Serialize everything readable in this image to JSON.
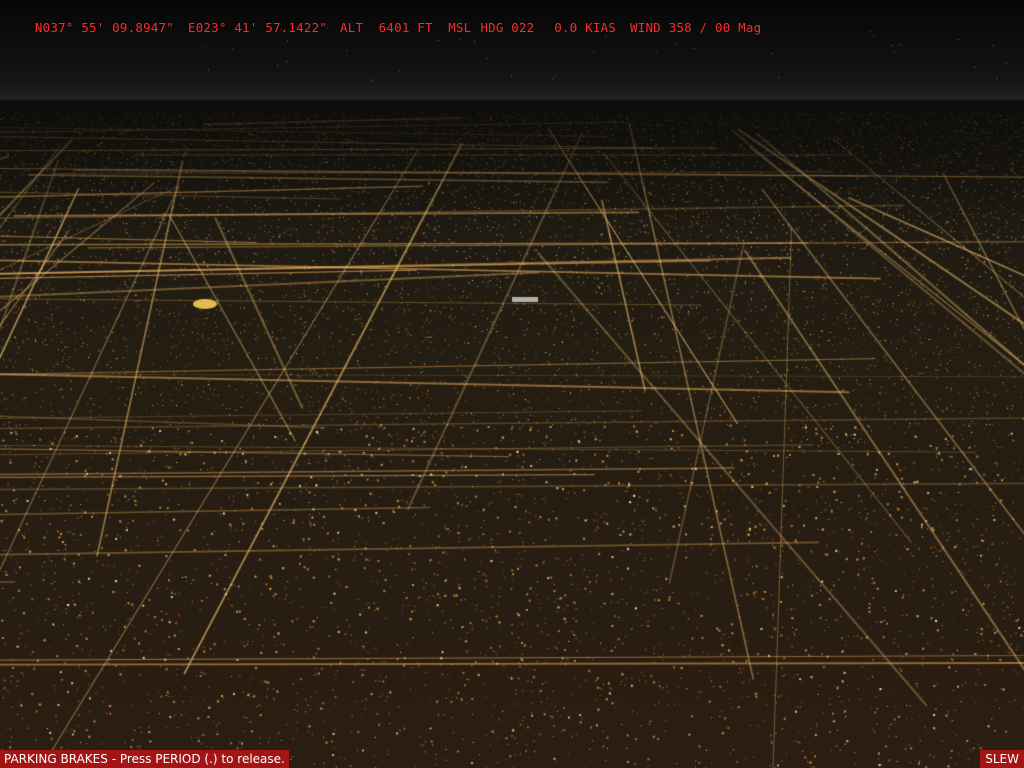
{
  "hud": {
    "latitude": "N037° 55' 09.8947\"",
    "longitude": "E023° 41' 57.1422\"",
    "altitude": "ALT  6401 FT  MSL",
    "heading": "HDG 022",
    "airspeed": " 0.0 KIAS",
    "wind": "WIND 358 / 00 Mag",
    "color": "#ff2a2a"
  },
  "messages": {
    "parking_brakes": "PARKING BRAKES - Press PERIOD (.) to release.",
    "slew": "SLEW",
    "bar_color": "#a31414"
  },
  "scene": {
    "description_icon": "night-city-terrain-view"
  }
}
